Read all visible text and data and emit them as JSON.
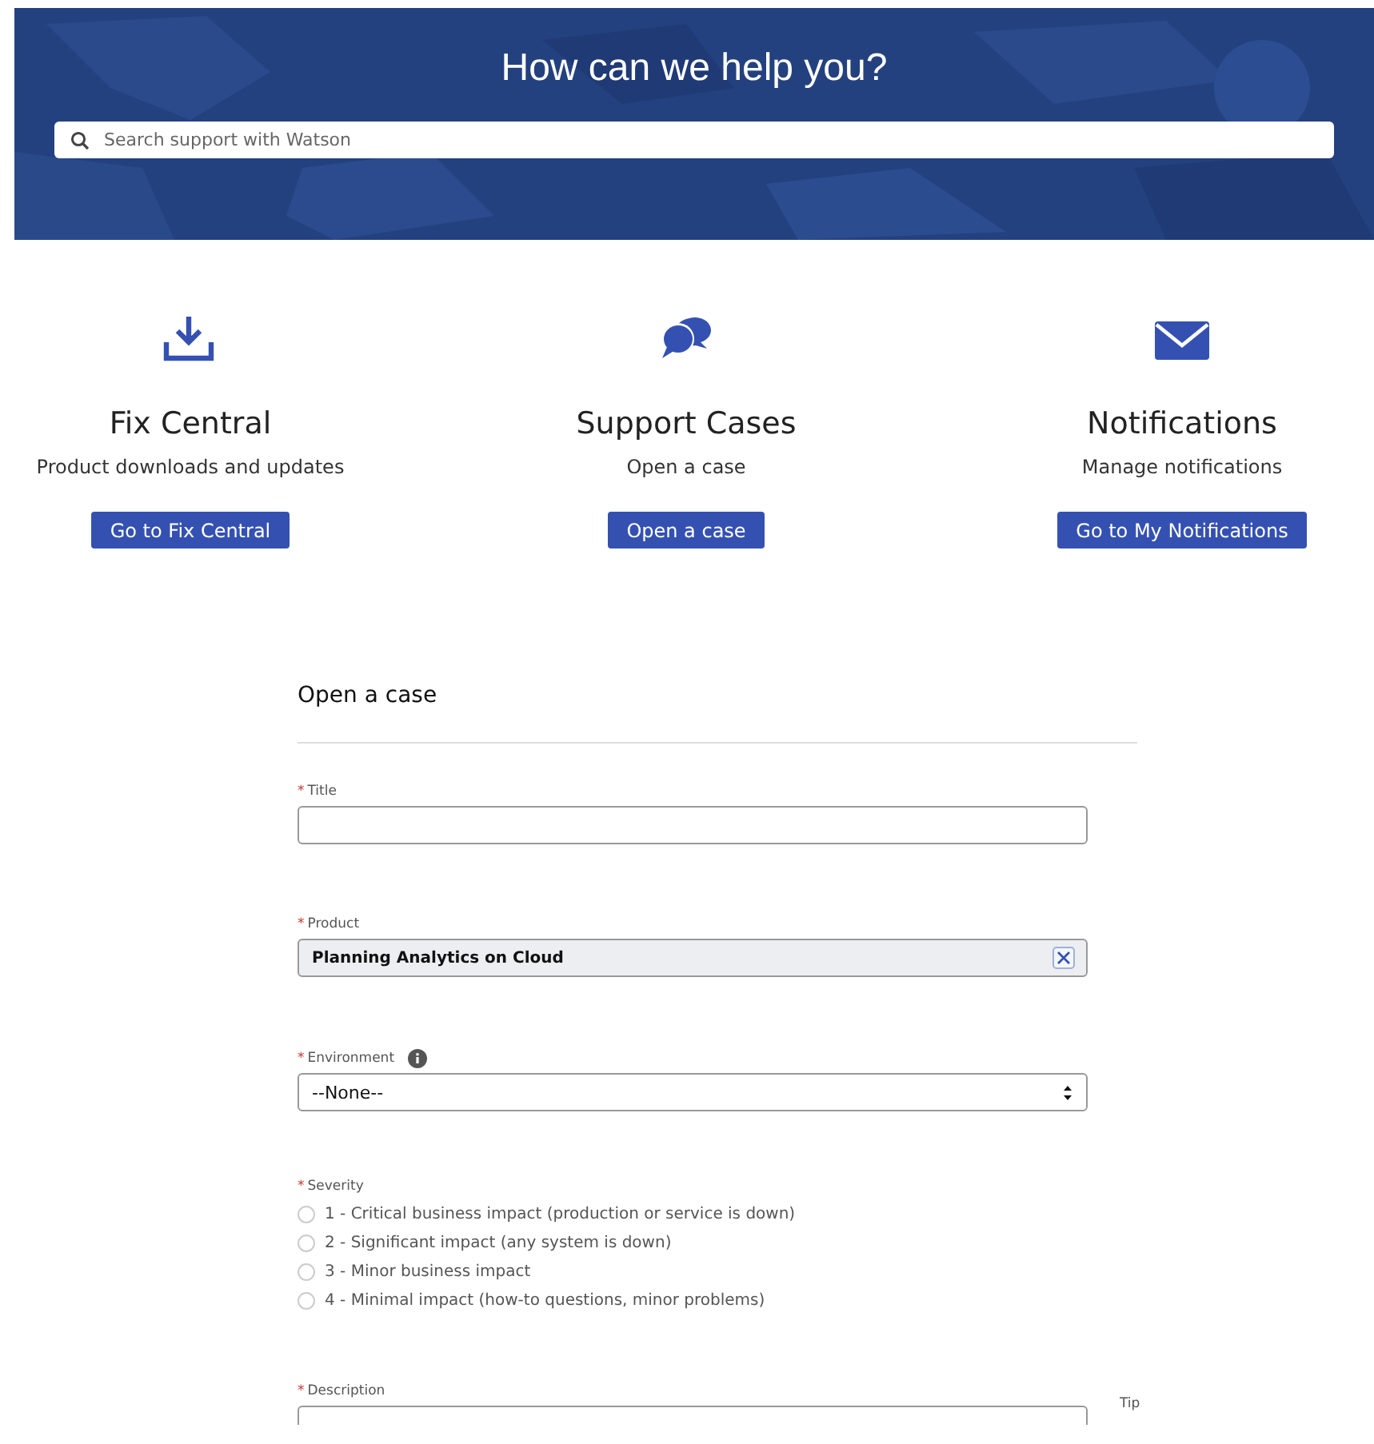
{
  "hero": {
    "title": "How can we help you?",
    "search": {
      "placeholder": "Search support with Watson"
    }
  },
  "cards": [
    {
      "kind": "download",
      "title": "Fix Central",
      "subtitle": "Product downloads and updates",
      "button": "Go to Fix Central"
    },
    {
      "kind": "chat",
      "title": "Support Cases",
      "subtitle": "Open a case",
      "button": "Open a case"
    },
    {
      "kind": "mail",
      "title": "Notifications",
      "subtitle": "Manage notifications",
      "button": "Go to My Notifications"
    }
  ],
  "form": {
    "title": "Open a case",
    "fields": [
      {
        "kind": "text",
        "required_mark": "*",
        "label": "Title"
      },
      {
        "kind": "lookup",
        "required_mark": "*",
        "label": "Product",
        "value": "Planning Analytics on Cloud"
      },
      {
        "kind": "select",
        "required_mark": "*",
        "label": "Environment",
        "info": true,
        "value": "--None--"
      },
      {
        "kind": "radio",
        "required_mark": "*",
        "label": "Severity",
        "options": [
          {
            "label": "1 - Critical business impact (production or service is down)",
            "selected": false
          },
          {
            "label": "2 - Significant impact (any system is down)",
            "selected": false
          },
          {
            "label": "3 - Minor business impact",
            "selected": false
          },
          {
            "label": "4 - Minimal impact (how-to questions, minor problems)",
            "selected": false
          }
        ]
      },
      {
        "kind": "textarea",
        "required_mark": "*",
        "label": "Description",
        "tip": "Tip"
      }
    ]
  }
}
